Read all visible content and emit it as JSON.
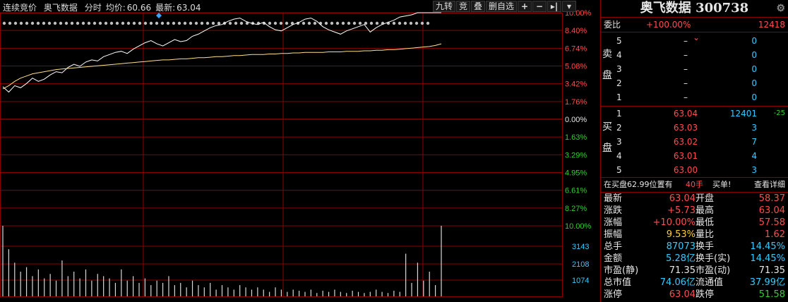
{
  "header": {
    "mode": "连续竞价",
    "stock_name": "奥飞数据",
    "view": "分时",
    "avg_label": "均价:",
    "avg_value": "60.66",
    "last_label": "最新:",
    "last_value": "63.04"
  },
  "toolbar": {
    "btn1": "九转",
    "btn2": "竞",
    "btn3": "叠",
    "btn4": "删自选",
    "plus_icon": "+",
    "minus_icon": "−",
    "step_icon": "▸|",
    "menu_icon": "▾"
  },
  "axis": {
    "pct_up": [
      "10.00%",
      "8.40%",
      "6.74%",
      "5.08%",
      "3.42%",
      "1.76%",
      "0.00%"
    ],
    "pct_down": [
      "1.63%",
      "3.29%",
      "4.95%",
      "6.61%",
      "8.27%",
      "10.00%"
    ],
    "vol_labels": [
      "3143",
      "2108",
      "1074"
    ]
  },
  "chart_data": {
    "type": "line",
    "series": [
      {
        "values": [
          3.1,
          2.6,
          3.2,
          3.0,
          3.4,
          3.9,
          3.6,
          3.8,
          4.2,
          4.5,
          4.4,
          4.9,
          5.2,
          5.0,
          5.4,
          5.6,
          5.5,
          5.9,
          6.1,
          6.3,
          6.4,
          6.2,
          6.6,
          6.9,
          7.2,
          7.4,
          7.1,
          6.9,
          7.2,
          7.5,
          7.3,
          7.4,
          7.8,
          8.0,
          8.3,
          8.6,
          8.8,
          8.9,
          9.2,
          9.4,
          9.5,
          9.2,
          9.0,
          8.9,
          9.1,
          8.7,
          8.4,
          8.3,
          8.6,
          8.9,
          9.1,
          9.4,
          9.5,
          9.2,
          8.7,
          8.4,
          8.2,
          8.0,
          8.3,
          8.5,
          8.7,
          8.9,
          8.2,
          8.6,
          8.9,
          9.1,
          9.3,
          9.6,
          9.7,
          9.8,
          10.0,
          10.0,
          10.0,
          10.0,
          10.0
        ]
      },
      {
        "values": [
          2.9,
          3.2,
          3.6,
          3.9,
          4.1,
          4.3,
          4.4,
          4.5,
          4.6,
          4.7,
          4.75,
          4.8,
          4.85,
          4.9,
          4.95,
          5.0,
          5.05,
          5.1,
          5.15,
          5.2,
          5.25,
          5.3,
          5.35,
          5.4,
          5.45,
          5.5,
          5.55,
          5.6,
          5.6,
          5.65,
          5.7,
          5.7,
          5.75,
          5.8,
          5.8,
          5.85,
          5.9,
          5.9,
          5.95,
          6.0,
          6.0,
          6.05,
          6.1,
          6.1,
          6.1,
          6.15,
          6.15,
          6.2,
          6.2,
          6.25,
          6.25,
          6.3,
          6.3,
          6.3,
          6.3,
          6.35,
          6.35,
          6.35,
          6.4,
          6.4,
          6.4,
          6.45,
          6.45,
          6.5,
          6.5,
          6.55,
          6.55,
          6.6,
          6.65,
          6.7,
          6.75,
          6.8,
          6.85,
          6.95,
          7.1
        ]
      }
    ],
    "volume": [
      3143,
      2100,
      1500,
      1100,
      1300,
      900,
      1200,
      800,
      1000,
      700,
      1600,
      900,
      1100,
      800,
      1200,
      700,
      1000,
      900,
      800,
      600,
      1200,
      700,
      900,
      600,
      800,
      500,
      700,
      600,
      900,
      500,
      600,
      400,
      700,
      500,
      400,
      600,
      300,
      500,
      400,
      300,
      500,
      400,
      300,
      400,
      300,
      200,
      400,
      300,
      200,
      300,
      250,
      200,
      300,
      150,
      250,
      200,
      300,
      200,
      150,
      250,
      200,
      150,
      200,
      300,
      200,
      150,
      250,
      200,
      1900,
      600,
      1500,
      700,
      1100,
      500,
      3143
    ],
    "ylim": [
      -10,
      10
    ]
  },
  "panel": {
    "name": "奥飞数据",
    "code": "300738",
    "wei_bi_label": "委比",
    "wei_bi_value": "+100.00%",
    "wei_cha": "12418",
    "sell_label": "卖盘",
    "buy_label": "买盘",
    "sell": [
      {
        "lvl": "5",
        "price": "–",
        "vol": "0"
      },
      {
        "lvl": "4",
        "price": "–",
        "vol": "0"
      },
      {
        "lvl": "3",
        "price": "–",
        "vol": "0"
      },
      {
        "lvl": "2",
        "price": "–",
        "vol": "0"
      },
      {
        "lvl": "1",
        "price": "–",
        "vol": "0"
      }
    ],
    "buy": [
      {
        "lvl": "1",
        "price": "63.04",
        "vol": "12401",
        "chg": "-25"
      },
      {
        "lvl": "2",
        "price": "63.03",
        "vol": "3",
        "chg": ""
      },
      {
        "lvl": "3",
        "price": "63.02",
        "vol": "7",
        "chg": ""
      },
      {
        "lvl": "4",
        "price": "63.01",
        "vol": "4",
        "chg": ""
      },
      {
        "lvl": "5",
        "price": "63.00",
        "vol": "3",
        "chg": ""
      }
    ],
    "position_text": "在买盘62.99位置有",
    "position_hands": "40手",
    "position_action": "买单!",
    "detail_link": "查看详细"
  },
  "stats": [
    {
      "l": "最新",
      "v": "63.04",
      "vc": "red",
      "l2": "开盘",
      "v2": "58.37",
      "v2c": "red"
    },
    {
      "l": "涨跌",
      "v": "+5.73",
      "vc": "red",
      "l2": "最高",
      "v2": "63.04",
      "v2c": "red"
    },
    {
      "l": "涨幅",
      "v": "+10.00%",
      "vc": "red",
      "l2": "最低",
      "v2": "57.58",
      "v2c": "red"
    },
    {
      "l": "振幅",
      "v": "9.53%",
      "vc": "yellow",
      "l2": "量比",
      "v2": "1.62",
      "v2c": "red"
    },
    {
      "l": "总手",
      "v": "87073",
      "vc": "cyan",
      "l2": "换手",
      "v2": "14.45%",
      "v2c": "cyan"
    },
    {
      "l": "金额",
      "v": "5.28亿",
      "vc": "cyan",
      "l2": "换手(实)",
      "v2": "14.45%",
      "v2c": "cyan"
    },
    {
      "l": "市盈(静)",
      "v": "71.35",
      "vc": "white",
      "l2": "市盈(动)",
      "v2": "71.35",
      "v2c": "white"
    },
    {
      "l": "总市值",
      "v": "74.06亿",
      "vc": "cyan",
      "l2": "流通值",
      "v2": "37.99亿",
      "v2c": "cyan"
    },
    {
      "l": "涨停",
      "v": "63.04",
      "vc": "red",
      "l2": "跌停",
      "v2": "51.58",
      "v2c": "green"
    }
  ],
  "colors": {
    "price_line": "#ffffff",
    "avg_line": "#ffe08a",
    "grid": "#8a0000",
    "up": "#ff4d4d",
    "down": "#33cc33"
  }
}
